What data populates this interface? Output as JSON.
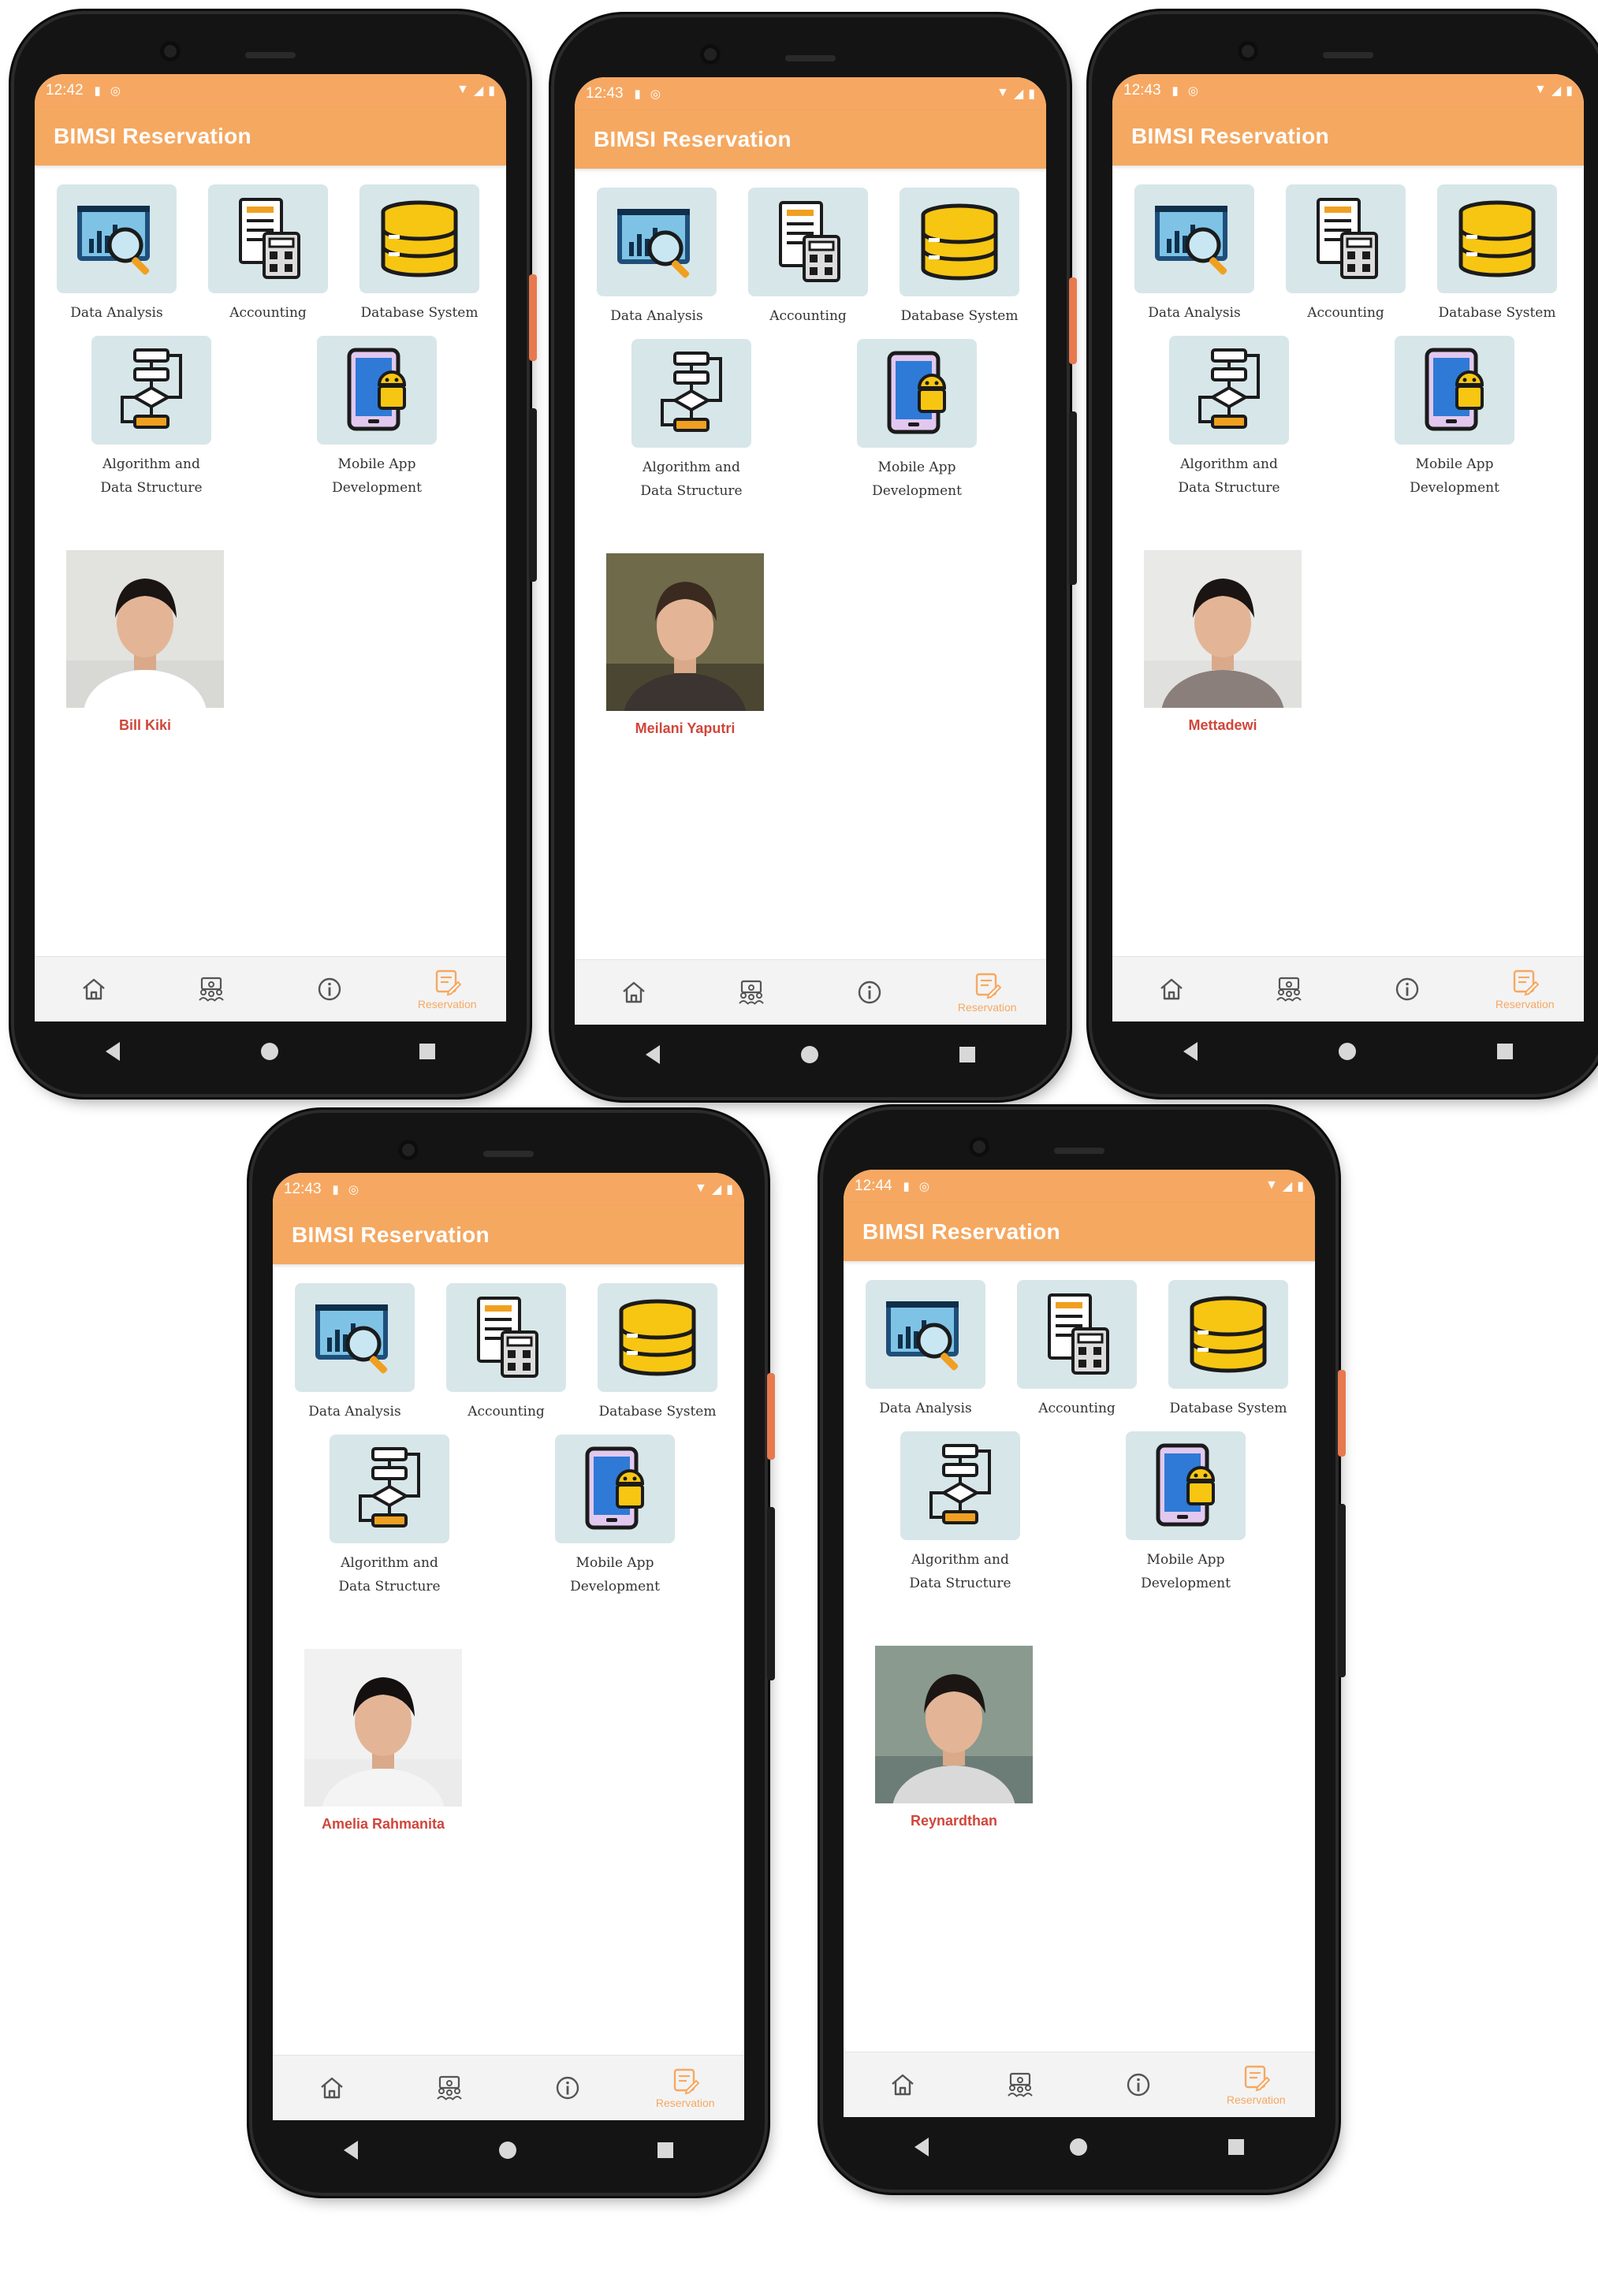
{
  "app": {
    "title": "BIMSI Reservation",
    "accent_color": "#f5a860",
    "tile_color": "#d7e6e9",
    "name_color": "#d0463b"
  },
  "courses": [
    {
      "label": "Data Analysis",
      "icon": "data-analysis-icon"
    },
    {
      "label": "Accounting",
      "icon": "accounting-calculator-icon"
    },
    {
      "label": "Database System",
      "icon": "database-icon"
    },
    {
      "label": "Algorithm and\nData Structure",
      "icon": "flowchart-icon"
    },
    {
      "label": "Mobile App\nDevelopment",
      "icon": "android-phone-icon"
    }
  ],
  "nav": {
    "home_icon": "home-icon",
    "mentors_icon": "group-icon",
    "info_icon": "info-icon",
    "reservation_icon": "reservation-icon",
    "reservation_label": "Reservation"
  },
  "screens": [
    {
      "time": "12:42",
      "mentor_name": "Bill Kiki"
    },
    {
      "time": "12:43",
      "mentor_name": "Meilani Yaputri"
    },
    {
      "time": "12:43",
      "mentor_name": "Mettadewi"
    },
    {
      "time": "12:43",
      "mentor_name": "Amelia Rahmanita"
    },
    {
      "time": "12:44",
      "mentor_name": "Reynardthan"
    }
  ]
}
